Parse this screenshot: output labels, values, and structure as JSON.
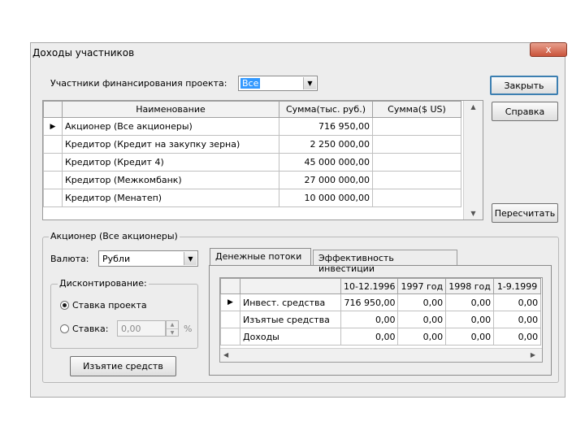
{
  "window": {
    "title": "Доходы участников",
    "close_glyph": "x"
  },
  "participants": {
    "label": "Участники финансирования проекта:",
    "selected": "Все",
    "columns": [
      "Наименование",
      "Сумма(тыс. руб.)",
      "Сумма($ US)"
    ],
    "rows": [
      {
        "name": "Акционер (Все акционеры)",
        "rub": "716 950,00",
        "usd": ""
      },
      {
        "name": "Кредитор (Кредит на закупку зерна)",
        "rub": "2 250 000,00",
        "usd": ""
      },
      {
        "name": "Кредитор (Кредит 4)",
        "rub": "45 000 000,00",
        "usd": ""
      },
      {
        "name": "Кредитор (Межкомбанк)",
        "rub": "27 000 000,00",
        "usd": ""
      },
      {
        "name": "Кредитор (Менатеп)",
        "rub": "10 000 000,00",
        "usd": ""
      }
    ]
  },
  "buttons": {
    "close": "Закрыть",
    "help": "Справка",
    "recalc": "Пересчитать",
    "withdraw": "Изъятие средств"
  },
  "shareholder_group": {
    "legend": "Акционер (Все акционеры)",
    "currency_label": "Валюта:",
    "currency_value": "Рубли",
    "discount_legend": "Дисконтирование:",
    "radio_project_rate": "Ставка проекта",
    "radio_rate": "Ставка:",
    "rate_value": "0,00",
    "percent": "%"
  },
  "tabs": [
    {
      "label": "Денежные потоки",
      "active": true
    },
    {
      "label": "Эффективность инвестиций",
      "active": false
    }
  ],
  "cashflow": {
    "columns": [
      "10-12.1996",
      "1997 год",
      "1998 год",
      "1-9.1999"
    ],
    "rows": [
      {
        "label": "Инвест. средства",
        "values": [
          "716 950,00",
          "0,00",
          "0,00",
          "0,00"
        ]
      },
      {
        "label": "Изъятые средства",
        "values": [
          "0,00",
          "0,00",
          "0,00",
          "0,00"
        ]
      },
      {
        "label": "Доходы",
        "values": [
          "0,00",
          "0,00",
          "0,00",
          "0,00"
        ]
      }
    ]
  }
}
